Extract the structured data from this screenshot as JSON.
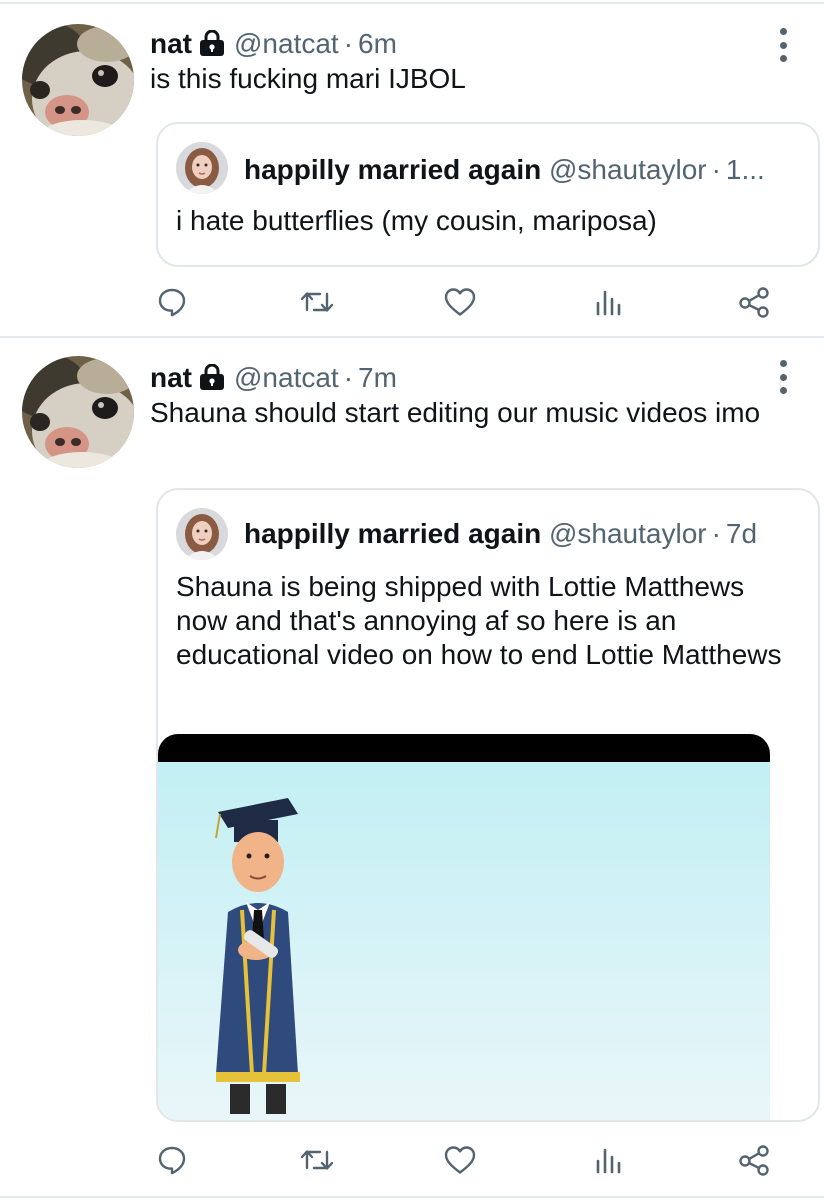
{
  "tweets": [
    {
      "author": {
        "name": "nat",
        "handle": "@natcat",
        "time": "6m"
      },
      "text": "is this fucking mari IJBOL",
      "quote": {
        "author": {
          "name": "happilly married again",
          "handle": "@shautaylor",
          "time": "1..."
        },
        "text": "i hate butterflies (my cousin, mariposa)"
      }
    },
    {
      "author": {
        "name": "nat",
        "handle": "@natcat",
        "time": "7m"
      },
      "text": "Shauna should start editing our music videos imo",
      "quote": {
        "author": {
          "name": "happilly married again",
          "handle": "@shautaylor",
          "time": "7d"
        },
        "text": "Shauna is being shipped with Lottie Matthews now and that's annoying af so here is an educational video on how to end Lottie Matthews"
      }
    }
  ],
  "separator": "·",
  "icons": {
    "reply": "reply-icon",
    "retweet": "retweet-icon",
    "like": "like-icon",
    "analytics": "analytics-icon",
    "share": "share-icon",
    "lock": "lock-icon",
    "more": "more-icon"
  },
  "colors": {
    "text": "#0f1419",
    "secondary": "#536471",
    "icon": "#536471",
    "divider": "#e6e9ec",
    "quote_border": "#e1e6ea",
    "video_sky_top": "#bfeff3",
    "video_sky_bottom": "#e9f6f9"
  }
}
